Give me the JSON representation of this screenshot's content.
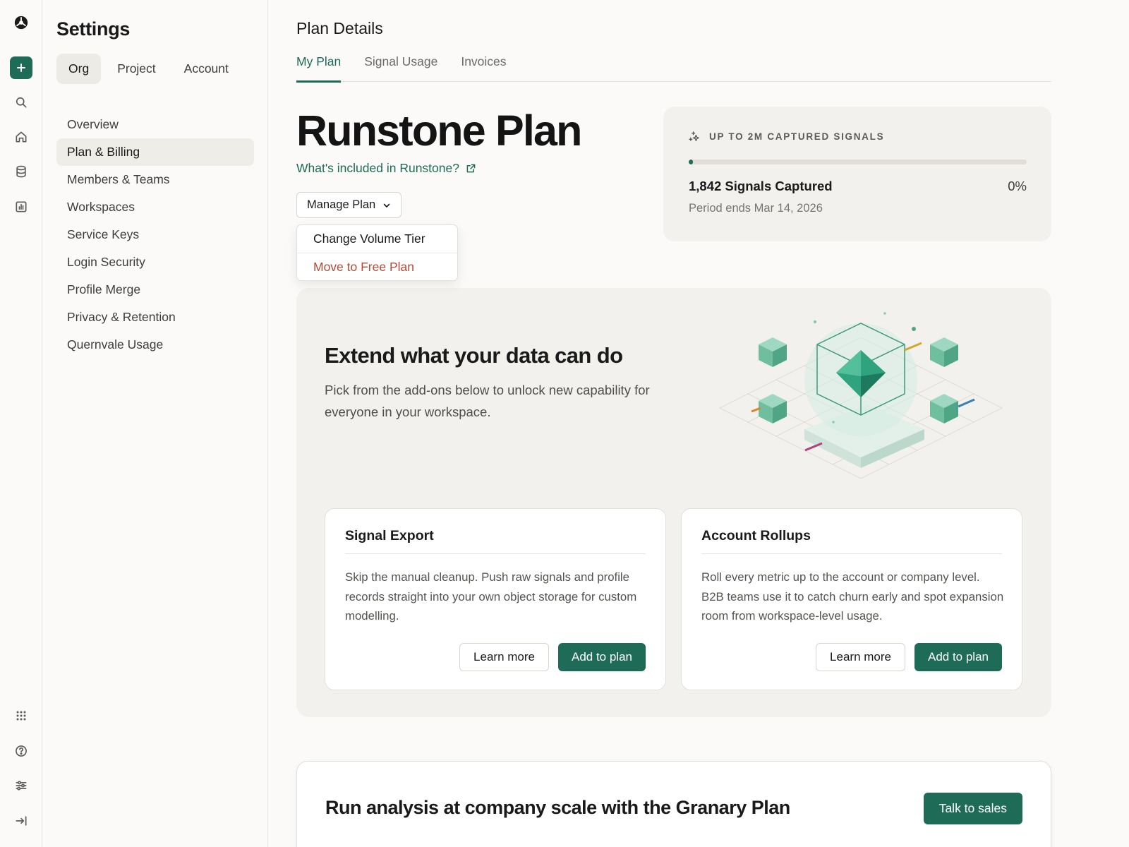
{
  "rail": {
    "icons": [
      "logo-icon",
      "plus-icon",
      "search-icon",
      "home-icon",
      "database-icon",
      "chart-icon",
      "grid-icon",
      "help-icon",
      "sliders-icon",
      "collapse-icon"
    ]
  },
  "settings": {
    "title": "Settings",
    "scopes": [
      "Org",
      "Project",
      "Account"
    ],
    "active_scope": "Org",
    "nav": [
      "Overview",
      "Plan & Billing",
      "Members & Teams",
      "Workspaces",
      "Service Keys",
      "Login Security",
      "Profile Merge",
      "Privacy & Retention",
      "Quernvale Usage"
    ],
    "active_nav": "Plan & Billing"
  },
  "main": {
    "title": "Plan Details",
    "tabs": [
      "My Plan",
      "Signal Usage",
      "Invoices"
    ],
    "active_tab": "My Plan",
    "plan_name": "Runstone Plan",
    "included_link": "What's included in Runstone?",
    "manage_button": "Manage Plan",
    "manage_menu": [
      "Change Volume Tier",
      "Move to Free Plan"
    ]
  },
  "usage": {
    "heading": "UP TO 2M CAPTURED SIGNALS",
    "captured": "1,842 Signals Captured",
    "percent": "0%",
    "progress_fraction": 0.005,
    "period": "Period ends Mar 14, 2026"
  },
  "addons": {
    "title": "Extend what your data can do",
    "subtitle": "Pick from the add-ons below to unlock new capability for everyone in your workspace.",
    "cards": [
      {
        "title": "Signal Export",
        "body": "Skip the manual cleanup. Push raw signals and profile records straight into your own object storage for custom modelling.",
        "learn": "Learn more",
        "add": "Add to plan"
      },
      {
        "title": "Account Rollups",
        "body": "Roll every metric up to the account or company level. B2B teams use it to catch churn early and spot expansion room from workspace-level usage.",
        "learn": "Learn more",
        "add": "Add to plan"
      }
    ]
  },
  "banner": {
    "title": "Run analysis at company scale with the Granary Plan",
    "cta": "Talk to sales"
  },
  "colors": {
    "accent": "#1e6b57",
    "danger": "#b24a36",
    "panel": "#f2f1ed"
  }
}
